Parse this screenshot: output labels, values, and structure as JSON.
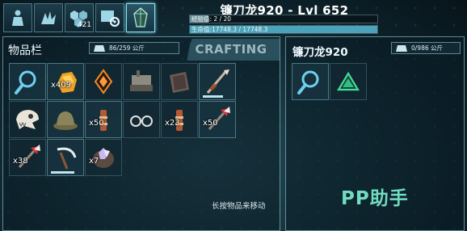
{
  "tabs": [
    {
      "icon": "survivor-icon"
    },
    {
      "icon": "dino-tame-icon"
    },
    {
      "icon": "engrams-icon",
      "count": "421"
    },
    {
      "icon": "tribe-settings-icon"
    },
    {
      "icon": "element-crystal-icon"
    }
  ],
  "creature": {
    "title": "镰刀龙920 - Lvl 652",
    "xp_text": "经验值: 2 / 20",
    "xp_fraction": 0.1,
    "hp_text": "生命值:17748.3 / 17748.3",
    "hp_fraction": 1.0
  },
  "player_inventory": {
    "title": "物品栏",
    "weight": "86/259 公斤",
    "crafting_label": "CRAFTING",
    "hint": "长按物品来移动",
    "items": [
      {
        "icon": "search-icon",
        "qty": ""
      },
      {
        "icon": "amber-icon",
        "qty": "x409"
      },
      {
        "icon": "artifact-icon",
        "qty": ""
      },
      {
        "icon": "smithy-icon",
        "qty": ""
      },
      {
        "icon": "fabricator-icon",
        "qty": ""
      },
      {
        "icon": "pike-icon",
        "qty": "",
        "durability": 0.7
      },
      {
        "icon": "dino-skull-icon",
        "qty": ""
      },
      {
        "icon": "pith-helmet-icon",
        "qty": ""
      },
      {
        "icon": "arrow-bundle-icon",
        "qty": "x50"
      },
      {
        "icon": "glasses-icon",
        "qty": ""
      },
      {
        "icon": "arrow-bundle-icon",
        "qty": "x23"
      },
      {
        "icon": "tranq-dart-icon",
        "qty": "x50"
      },
      {
        "icon": "tranq-dart-icon",
        "qty": "x38"
      },
      {
        "icon": "sickle-icon",
        "qty": "",
        "durability": 0.8
      },
      {
        "icon": "crystal-bowl-icon",
        "qty": "x7"
      }
    ]
  },
  "creature_inventory": {
    "title": "镰刀龙920",
    "weight": "0/986 公斤",
    "items": [
      {
        "icon": "search-icon"
      },
      {
        "icon": "element-shard-icon"
      }
    ]
  },
  "watermark": "PP助手"
}
